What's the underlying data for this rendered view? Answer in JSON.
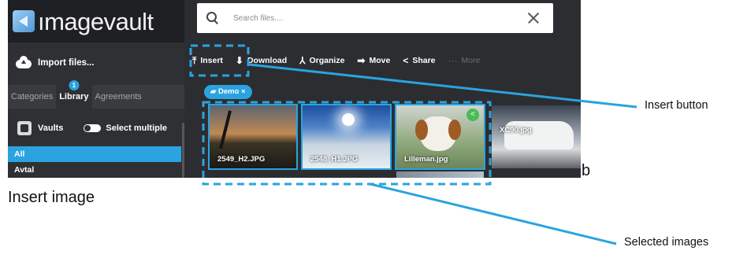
{
  "app": {
    "logo_text": "ımagevault",
    "import_label": "Import files...",
    "tabs": [
      {
        "label": "Categories",
        "active": false
      },
      {
        "label": "Library",
        "active": true,
        "badge": "1"
      },
      {
        "label": "Agreements",
        "active": false
      }
    ],
    "vaults_label": "Vaults",
    "select_multiple_label": "Select multiple",
    "vault_items": [
      {
        "label": "All",
        "selected": true
      },
      {
        "label": "Avtal",
        "selected": false
      }
    ]
  },
  "search": {
    "placeholder": "Search files...."
  },
  "toolbar": {
    "insert": "Insert",
    "download": "Download",
    "organize": "Organize",
    "move": "Move",
    "share": "Share",
    "more": "More"
  },
  "filter_chip": {
    "label": "Demo ×"
  },
  "gallery": {
    "items": [
      {
        "filename": "2549_H2.JPG",
        "selected": true
      },
      {
        "filename": "2548_H1.JPG",
        "selected": true
      },
      {
        "filename": "Lilleman.jpg",
        "selected": true
      },
      {
        "filename": "XC90.jpg",
        "selected": false
      }
    ]
  },
  "annotations": {
    "insert_button_label": "Insert button",
    "selected_images_label": "Selected images",
    "caption": "Insert image",
    "stray_text": "b"
  },
  "colors": {
    "accent": "#2aa3e0",
    "app_background": "#2c2d31",
    "sidebar_background": "#2f3034"
  }
}
